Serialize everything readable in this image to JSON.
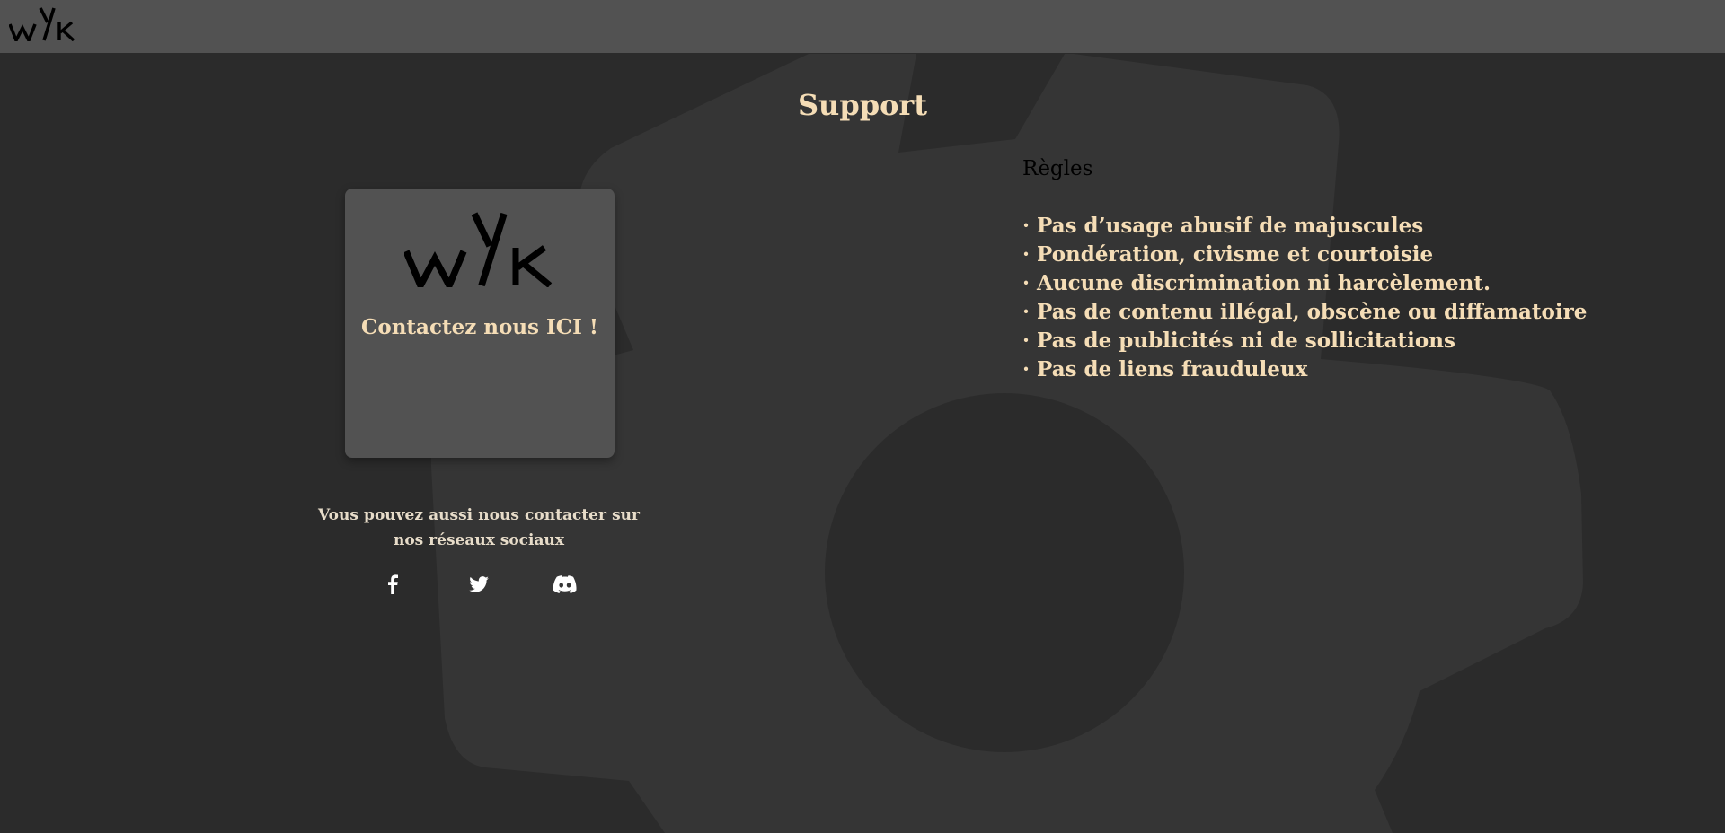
{
  "header": {
    "logo_text": "wYk"
  },
  "page": {
    "title": "Support"
  },
  "contact_card": {
    "logo_text": "wYk",
    "label": "Contactez nous ICI !"
  },
  "social": {
    "text": "Vous pouvez aussi nous contacter sur nos réseaux sociaux",
    "icons": [
      "facebook-icon",
      "twitter-icon",
      "discord-icon"
    ]
  },
  "rules": {
    "title": "Règles",
    "items": [
      "· Pas d’usage abusif de majuscules",
      "· Pondération, civisme et courtoisie",
      "· Aucune discrimination ni harcèlement.",
      "· Pas de contenu illégal, obscène ou diffamatoire",
      "· Pas de publicités ni de sollicitations",
      "· Pas de liens frauduleux"
    ]
  },
  "colors": {
    "background": "#2b2b2b",
    "topbar": "#525252",
    "card": "#525252",
    "accent_text": "#f5ddb6",
    "gear": "#353535"
  }
}
